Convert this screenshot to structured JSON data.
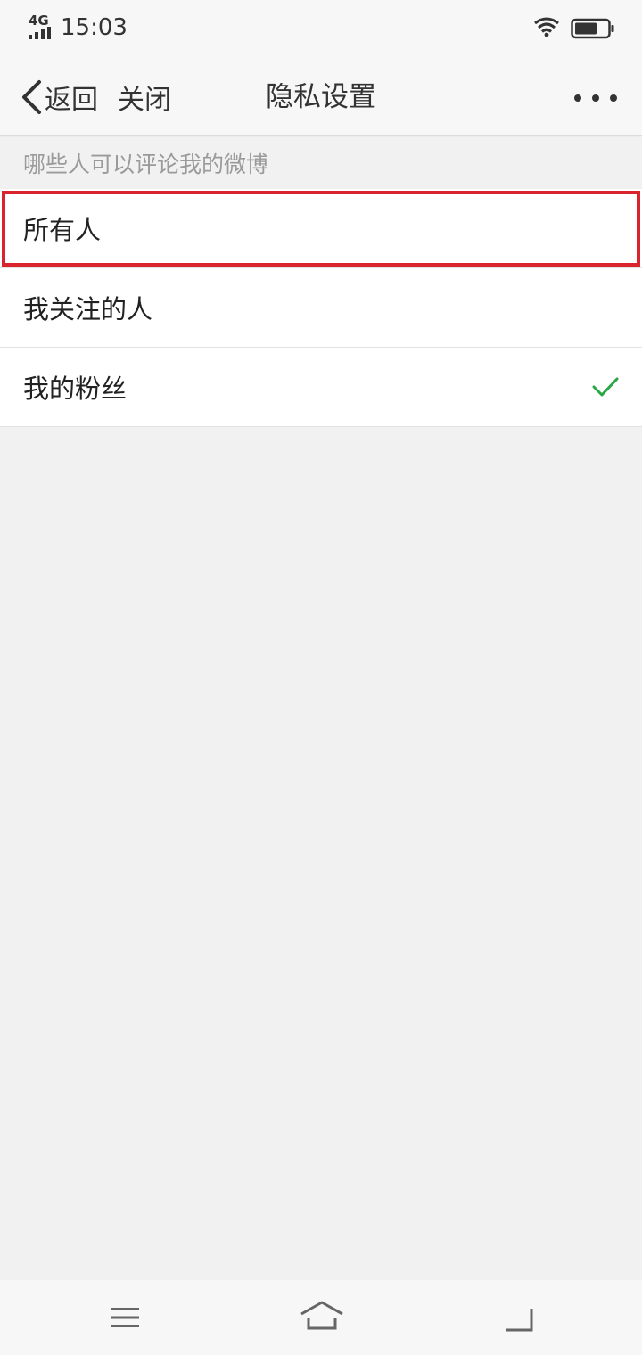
{
  "status_bar": {
    "network": "4G",
    "time": "15:03",
    "icons": [
      "signal-icon",
      "wifi-icon",
      "battery-icon"
    ]
  },
  "nav_bar": {
    "back_label": "返回",
    "close_label": "关闭",
    "title": "隐私设置",
    "more_icon": "more-dots-icon"
  },
  "section": {
    "header": "哪些人可以评论我的微博"
  },
  "options": [
    {
      "label": "所有人",
      "selected": false,
      "highlighted": true
    },
    {
      "label": "我关注的人",
      "selected": false,
      "highlighted": false
    },
    {
      "label": "我的粉丝",
      "selected": true,
      "highlighted": false
    }
  ],
  "system_nav": {
    "icons": [
      "menu-icon",
      "home-icon",
      "back-icon"
    ]
  },
  "colors": {
    "highlight_border": "#d9232d",
    "checkmark": "#2aa745",
    "background": "#f1f1f1",
    "section_header_text": "#9a9a9a"
  }
}
